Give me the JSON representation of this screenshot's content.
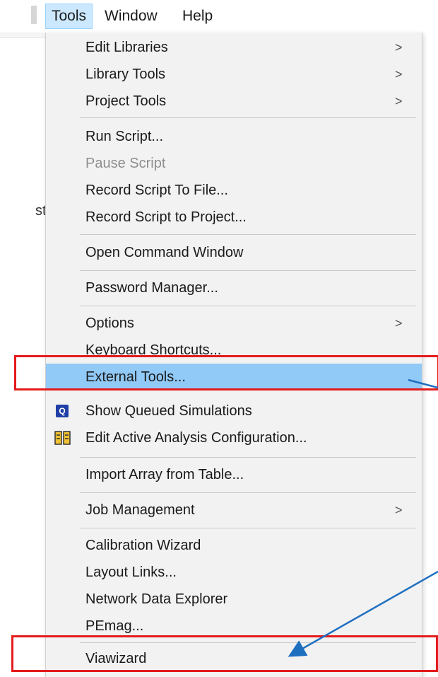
{
  "menubar": {
    "items": [
      "Tools",
      "Window",
      "Help"
    ]
  },
  "background": {
    "left_text": "st"
  },
  "menu": {
    "items": [
      {
        "label": "Edit Libraries",
        "submenu": true
      },
      {
        "label": "Library Tools",
        "submenu": true
      },
      {
        "label": "Project Tools",
        "submenu": true
      },
      {
        "label": "Run Script..."
      },
      {
        "label": "Pause Script",
        "disabled": true
      },
      {
        "label": "Record Script To File..."
      },
      {
        "label": "Record Script to Project..."
      },
      {
        "label": "Open Command Window"
      },
      {
        "label": "Password Manager..."
      },
      {
        "label": "Options",
        "submenu": true
      },
      {
        "label": "Keyboard Shortcuts..."
      },
      {
        "label": "External Tools...",
        "highlighted": true
      },
      {
        "label": "Show Queued Simulations",
        "icon": "queue-icon"
      },
      {
        "label": "Edit Active Analysis Configuration...",
        "icon": "analysis-config-icon"
      },
      {
        "label": "Import Array from Table..."
      },
      {
        "label": "Job Management",
        "submenu": true
      },
      {
        "label": "Calibration Wizard"
      },
      {
        "label": "Layout Links..."
      },
      {
        "label": "Network Data Explorer"
      },
      {
        "label": "PEmag..."
      },
      {
        "label": "Viawizard"
      }
    ],
    "submenu_arrow": ">"
  },
  "colors": {
    "highlight": "#91c9f7",
    "annotation_box": "#e41b1b",
    "annotation_arrow": "#1f6fbf"
  }
}
